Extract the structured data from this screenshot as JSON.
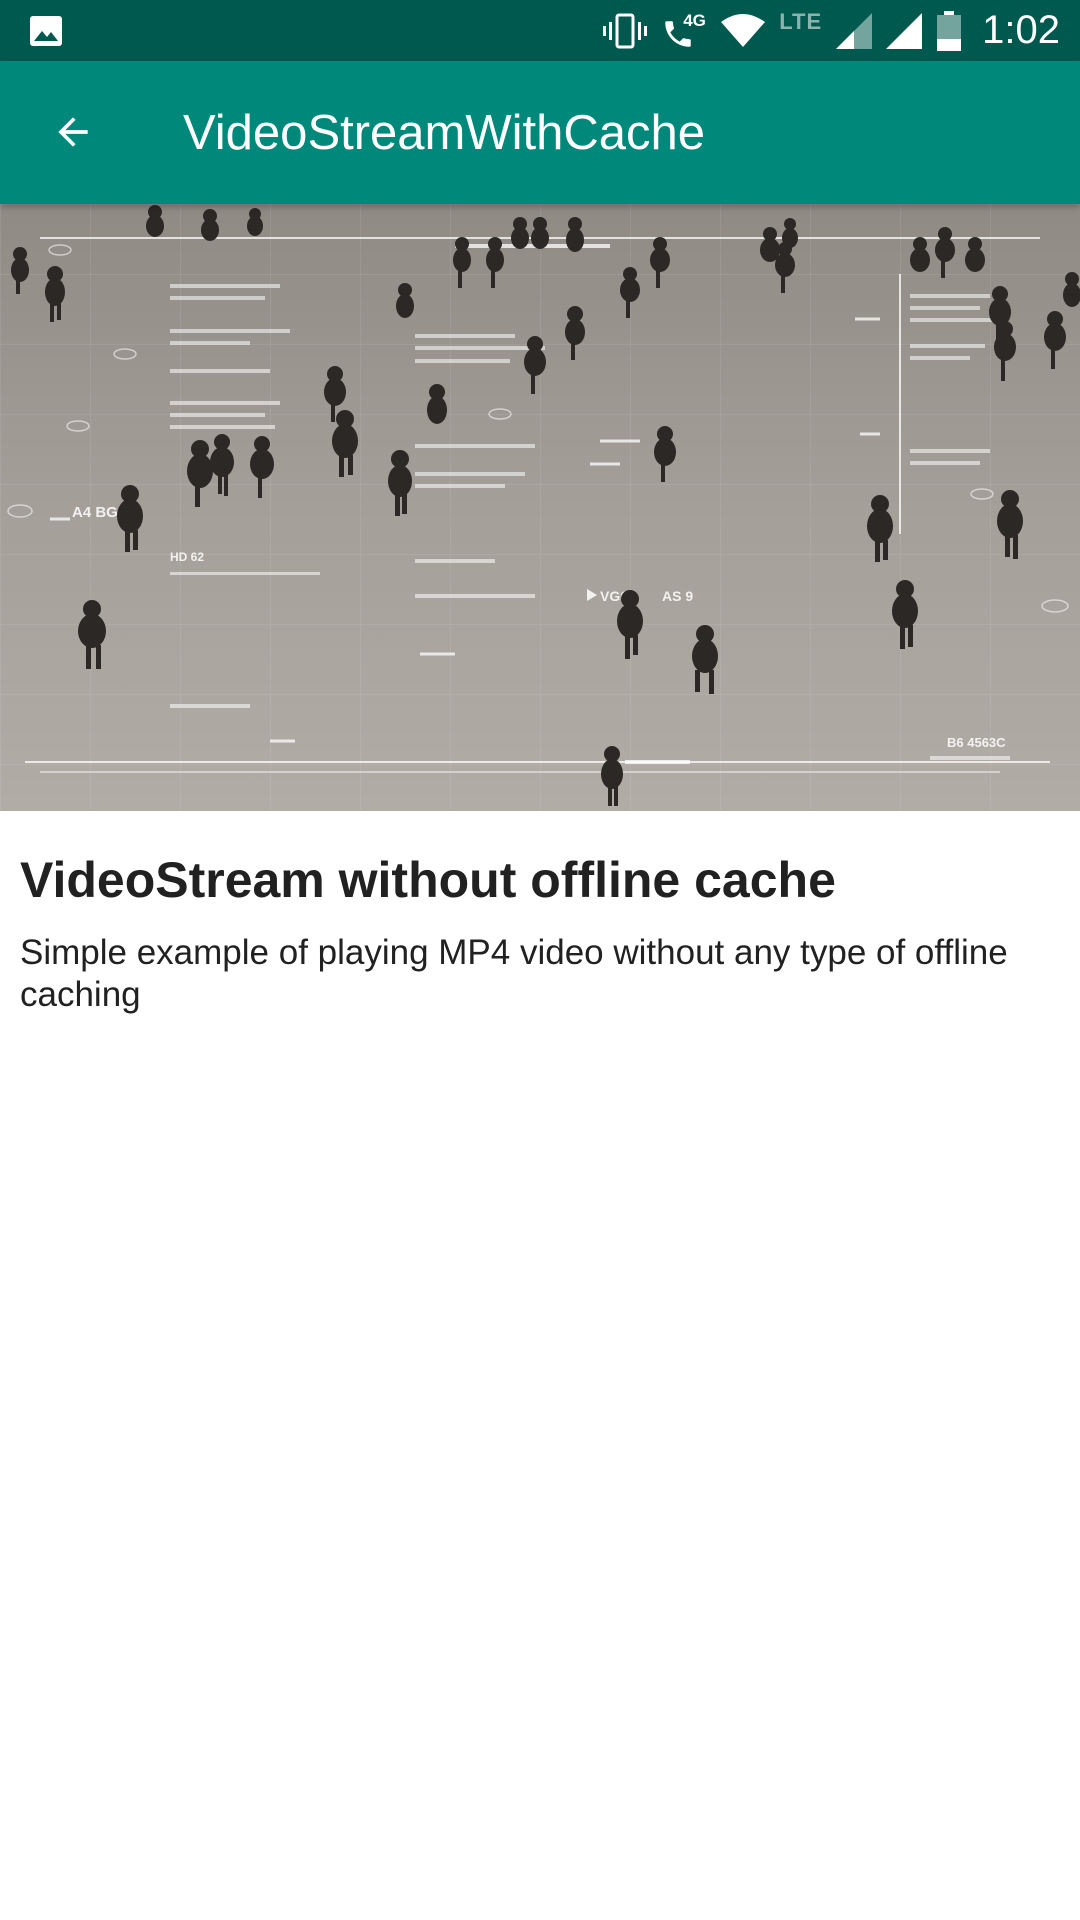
{
  "status_bar": {
    "notification_icon": "image-icon",
    "icons": [
      "vibrate-icon",
      "volte-call-icon",
      "wifi-icon",
      "signal-icon",
      "signal-icon",
      "battery-icon"
    ],
    "call_network_label": "4G",
    "lte_label": "LTE",
    "time": "1:02",
    "background_color": "#00594f"
  },
  "app_bar": {
    "title": "VideoStreamWithCache",
    "back_icon": "arrow-back-icon",
    "background_color": "#00897b"
  },
  "video": {
    "overlay_labels": [
      "A4 BG",
      "HD 62",
      "VG61",
      "AS 9",
      "B6 4563C"
    ]
  },
  "content": {
    "title": "VideoStream without offline cache",
    "description": "Simple example of playing MP4 video without any type of offline caching"
  }
}
